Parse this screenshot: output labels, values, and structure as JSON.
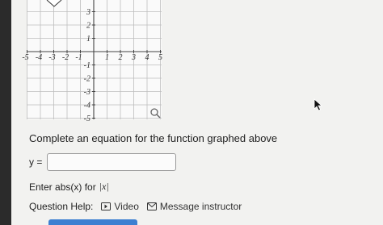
{
  "graph": {
    "x_tick_labels": [
      "-5",
      "-4",
      "-3",
      "-2",
      "-1",
      "1",
      "2",
      "3",
      "4",
      "5"
    ],
    "y_tick_labels": [
      "3",
      "2",
      "1",
      "-1",
      "-2",
      "-3",
      "-4",
      "-5"
    ],
    "magnify_icon": "magnifier-icon"
  },
  "question": {
    "prompt": "Complete an equation for the function graphed above",
    "answer_label": "y =",
    "answer_value": "",
    "hint_text": "Enter abs(x) for",
    "hint_math": "|x|"
  },
  "help": {
    "label": "Question Help:",
    "video_label": "Video",
    "message_label": "Message instructor"
  }
}
